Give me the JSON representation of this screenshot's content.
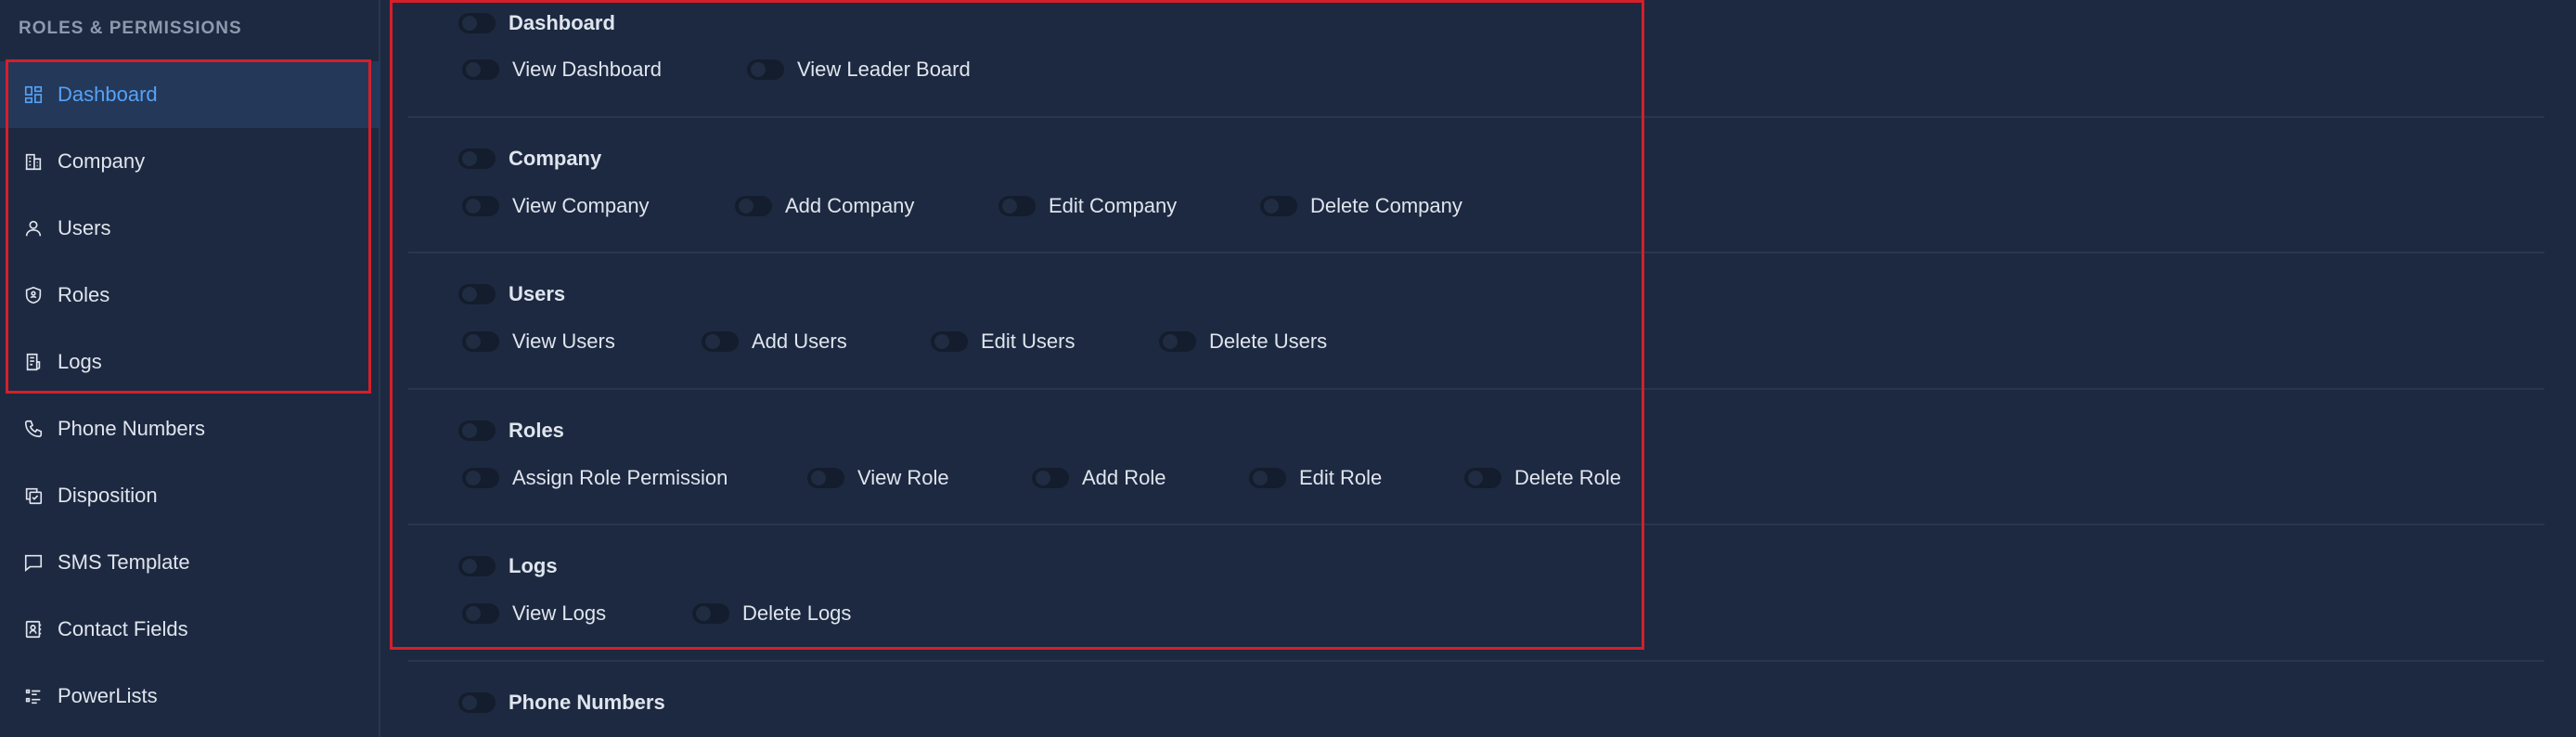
{
  "sidebar": {
    "title": "ROLES & PERMISSIONS",
    "items": [
      {
        "label": "Dashboard",
        "icon": "grid-icon",
        "active": true
      },
      {
        "label": "Company",
        "icon": "building-icon"
      },
      {
        "label": "Users",
        "icon": "user-icon"
      },
      {
        "label": "Roles",
        "icon": "shield-icon"
      },
      {
        "label": "Logs",
        "icon": "document-icon"
      },
      {
        "label": "Phone Numbers",
        "icon": "phone-icon"
      },
      {
        "label": "Disposition",
        "icon": "copy-icon"
      },
      {
        "label": "SMS Template",
        "icon": "message-icon"
      },
      {
        "label": "Contact Fields",
        "icon": "contact-book-icon"
      },
      {
        "label": "PowerLists",
        "icon": "list-icon"
      }
    ]
  },
  "sections": [
    {
      "name": "Dashboard",
      "perms": [
        "View Dashboard",
        "View Leader Board"
      ]
    },
    {
      "name": "Company",
      "perms": [
        "View Company",
        "Add Company",
        "Edit Company",
        "Delete Company"
      ]
    },
    {
      "name": "Users",
      "perms": [
        "View Users",
        "Add Users",
        "Edit Users",
        "Delete Users"
      ]
    },
    {
      "name": "Roles",
      "perms": [
        "Assign Role Permission",
        "View Role",
        "Add Role",
        "Edit Role",
        "Delete Role"
      ]
    },
    {
      "name": "Logs",
      "perms": [
        "View Logs",
        "Delete Logs"
      ]
    },
    {
      "name": "Phone Numbers",
      "perms": []
    }
  ],
  "colors": {
    "background": "#1d2940",
    "active_item_bg": "#24385a",
    "accent": "#56a2f7",
    "highlight": "#d51f2a"
  }
}
